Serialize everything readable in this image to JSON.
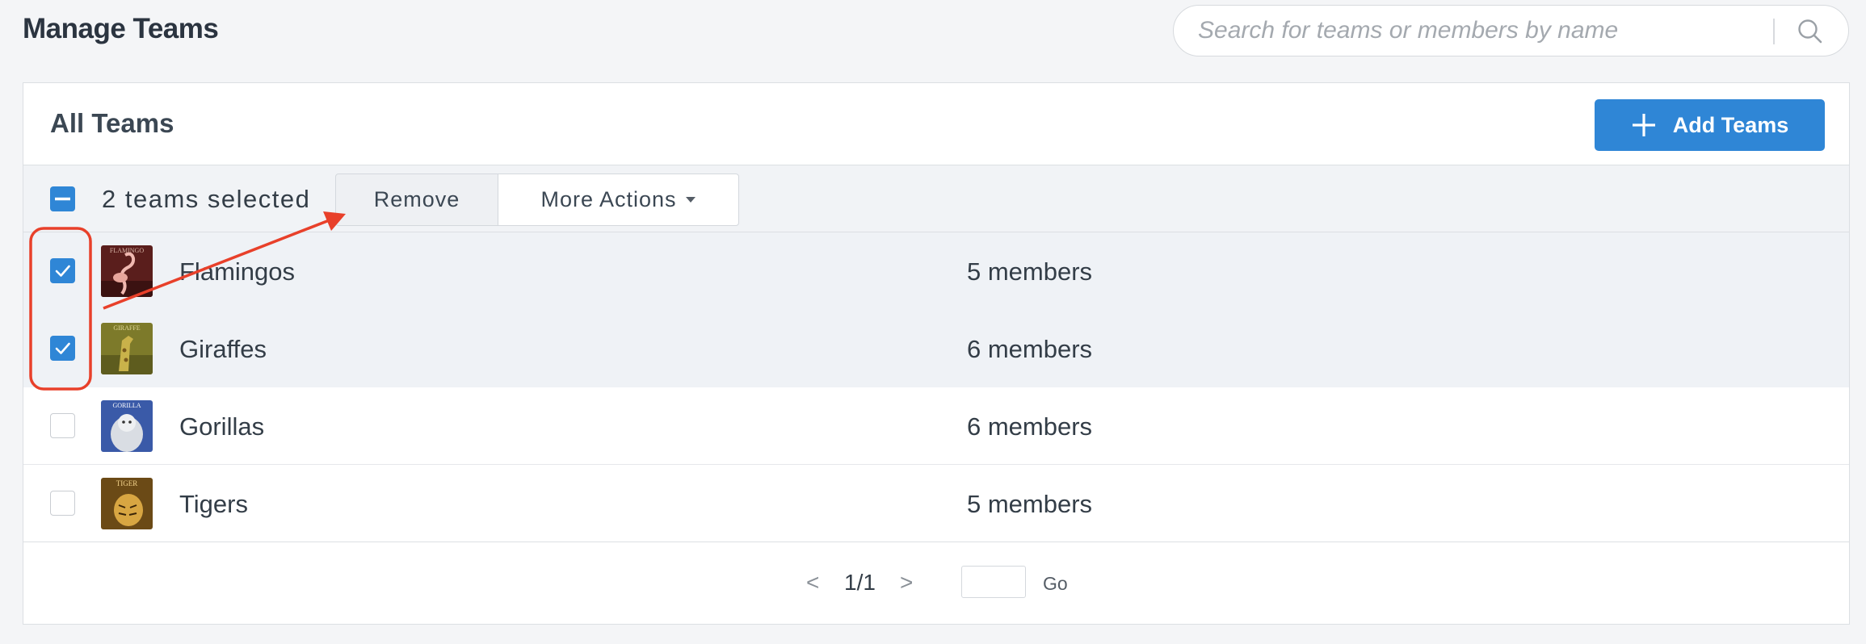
{
  "page": {
    "title": "Manage Teams"
  },
  "search": {
    "placeholder": "Search for teams or members by name"
  },
  "panel": {
    "title": "All Teams",
    "add_button_label": "Add Teams"
  },
  "action_bar": {
    "selected_text": "2 teams selected",
    "remove_label": "Remove",
    "more_actions_label": "More Actions"
  },
  "teams": [
    {
      "name": "Flamingos",
      "members": "5 members",
      "checked": true,
      "avatar_text": "FLAMINGO"
    },
    {
      "name": "Giraffes",
      "members": "6 members",
      "checked": true,
      "avatar_text": "GIRAFFE"
    },
    {
      "name": "Gorillas",
      "members": "6 members",
      "checked": false,
      "avatar_text": "GORILLA"
    },
    {
      "name": "Tigers",
      "members": "5 members",
      "checked": false,
      "avatar_text": "TIGER"
    }
  ],
  "pager": {
    "prev": "<",
    "page_label": "1/1",
    "next": ">",
    "go_label": "Go"
  },
  "colors": {
    "accent": "#2f86d6",
    "annotation": "#e8402a"
  }
}
